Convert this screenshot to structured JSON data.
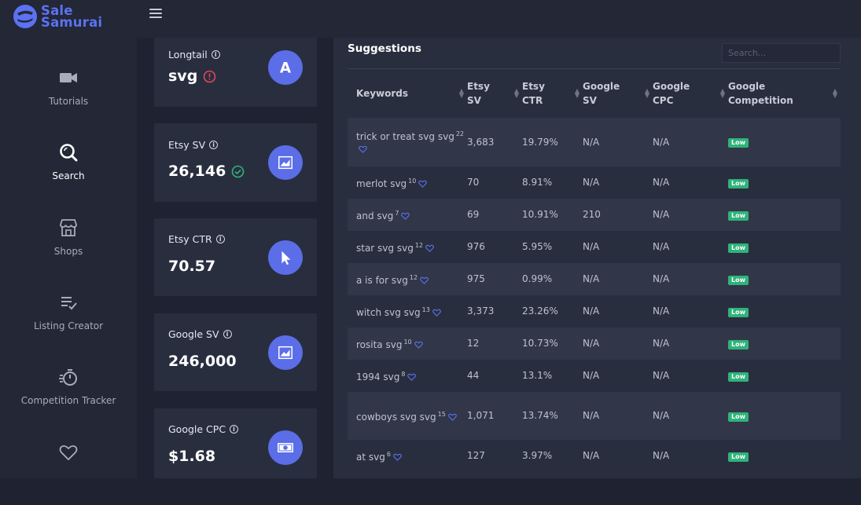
{
  "logo": {
    "line1": "Sale",
    "line2": "Samurai"
  },
  "sidebar": {
    "items": [
      {
        "label": "Tutorials",
        "icon": "video-camera-icon"
      },
      {
        "label": "Search",
        "icon": "search-icon"
      },
      {
        "label": "Shops",
        "icon": "storefront-icon"
      },
      {
        "label": "Listing Creator",
        "icon": "list-check-icon"
      },
      {
        "label": "Competition Tracker",
        "icon": "stopwatch-icon"
      },
      {
        "label": "",
        "icon": "heart-icon"
      }
    ]
  },
  "cards": [
    {
      "label": "Longtail",
      "value": "svg",
      "icon": "letter-a-icon",
      "status": "alert-icon"
    },
    {
      "label": "Etsy SV",
      "value": "26,146",
      "icon": "trend-chart-icon",
      "status": "check-icon"
    },
    {
      "label": "Etsy CTR",
      "value": "70.57",
      "icon": "cursor-icon"
    },
    {
      "label": "Google SV",
      "value": "246,000",
      "icon": "trend-chart-icon"
    },
    {
      "label": "Google CPC",
      "value": "$1.68",
      "icon": "money-bill-icon"
    }
  ],
  "suggestions": {
    "title": "Suggestions",
    "search_placeholder": "Search...",
    "columns": [
      "Keywords",
      "Etsy SV",
      "Etsy CTR",
      "Google SV",
      "Google CPC",
      "Google Competition"
    ],
    "column_lines": [
      [
        "Keywords"
      ],
      [
        "Etsy",
        "SV"
      ],
      [
        "Etsy",
        "CTR"
      ],
      [
        "Google",
        "SV"
      ],
      [
        "Google",
        "CPC"
      ],
      [
        "Google",
        "Competition"
      ]
    ],
    "rows": [
      {
        "keyword": "trick or treat svg svg",
        "count": "22",
        "etsy_sv": "3,683",
        "etsy_ctr": "19.79%",
        "google_sv": "N/A",
        "google_cpc": "N/A",
        "competition": "Low"
      },
      {
        "keyword": "merlot svg",
        "count": "10",
        "etsy_sv": "70",
        "etsy_ctr": "8.91%",
        "google_sv": "N/A",
        "google_cpc": "N/A",
        "competition": "Low"
      },
      {
        "keyword": "and svg",
        "count": "7",
        "etsy_sv": "69",
        "etsy_ctr": "10.91%",
        "google_sv": "210",
        "google_cpc": "N/A",
        "competition": "Low"
      },
      {
        "keyword": "star svg svg",
        "count": "12",
        "etsy_sv": "976",
        "etsy_ctr": "5.95%",
        "google_sv": "N/A",
        "google_cpc": "N/A",
        "competition": "Low"
      },
      {
        "keyword": "a is for svg",
        "count": "12",
        "etsy_sv": "975",
        "etsy_ctr": "0.99%",
        "google_sv": "N/A",
        "google_cpc": "N/A",
        "competition": "Low"
      },
      {
        "keyword": "witch svg svg",
        "count": "13",
        "etsy_sv": "3,373",
        "etsy_ctr": "23.26%",
        "google_sv": "N/A",
        "google_cpc": "N/A",
        "competition": "Low"
      },
      {
        "keyword": "rosita svg",
        "count": "10",
        "etsy_sv": "12",
        "etsy_ctr": "10.73%",
        "google_sv": "N/A",
        "google_cpc": "N/A",
        "competition": "Low"
      },
      {
        "keyword": "1994 svg",
        "count": "8",
        "etsy_sv": "44",
        "etsy_ctr": "13.1%",
        "google_sv": "N/A",
        "google_cpc": "N/A",
        "competition": "Low"
      },
      {
        "keyword": "cowboys svg svg",
        "count": "15",
        "etsy_sv": "1,071",
        "etsy_ctr": "13.74%",
        "google_sv": "N/A",
        "google_cpc": "N/A",
        "competition": "Low"
      },
      {
        "keyword": "at svg",
        "count": "6",
        "etsy_sv": "127",
        "etsy_ctr": "3.97%",
        "google_sv": "N/A",
        "google_cpc": "N/A",
        "competition": "Low"
      }
    ]
  },
  "colors": {
    "accent": "#5b6ee8",
    "badge_low": "#2fb37a",
    "alert": "#e0475a",
    "check": "#2fb37a"
  }
}
